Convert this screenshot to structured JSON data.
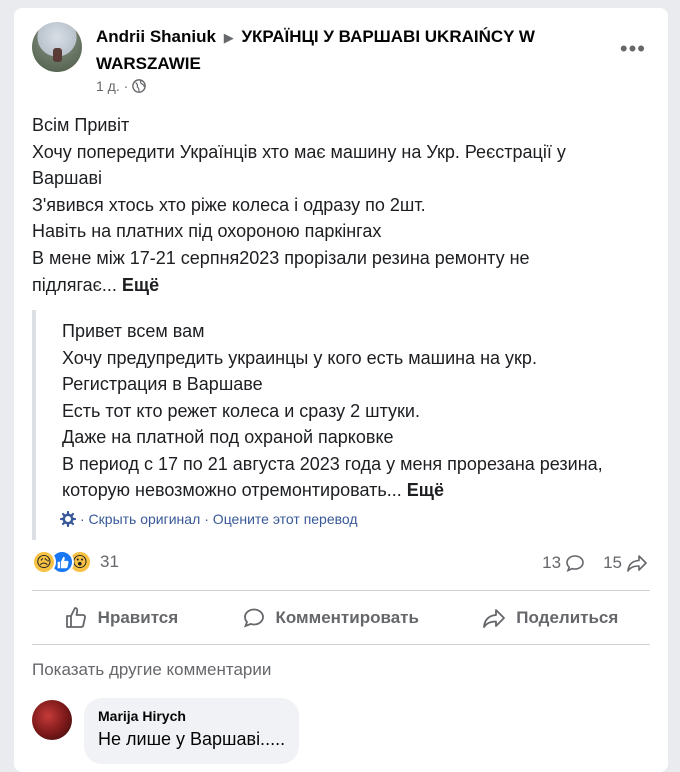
{
  "post": {
    "author": "Andrii Shaniuk",
    "group": "УКРАЇНЦІ У ВАРШАВІ UKRAIŃCY W WARSZAWIE",
    "time": "1 д. ·",
    "text_lines": [
      "Всім Привіт",
      "Хочу попередити Українців хто має машину на Укр. Реєстрації у",
      "Варшаві",
      "З'явився хтось хто ріже колеса і одразу по 2шт.",
      "Навіть на платних під охороною паркінгах",
      "В мене між 17-21 серпня2023 прорізали резина ремонту не",
      "підлягає..."
    ],
    "see_more": "Ещё"
  },
  "translation": {
    "lines": [
      "Привет всем вам",
      "Хочу предупредить украинцы у кого есть машина на укр.",
      "Регистрация в Варшаве",
      "Есть тот кто режет колеса и сразу 2 штуки.",
      "Даже на платной под охраной парковке",
      "В период с 17 по 21 августа 2023 года у меня прорезана резина,",
      "которую невозможно отремонтировать..."
    ],
    "see_more": "Ещё",
    "hide_original": "· Скрыть оригинал",
    "rate": "· Оцените этот перевод"
  },
  "stats": {
    "reactions_count": "31",
    "comments_count": "13",
    "shares_count": "15"
  },
  "actions": {
    "like": "Нравится",
    "comment": "Комментировать",
    "share": "Поделиться"
  },
  "comments": {
    "show_more": "Показать другие комментарии",
    "items": [
      {
        "author": "Marija Hirych",
        "text": "Не лише у Варшаві....."
      }
    ]
  },
  "icons": {
    "options": "more-horizontal-icon",
    "privacy": "globe-icon",
    "translate": "gear-icon",
    "comment_stat": "speech-bubble-icon",
    "share_stat": "share-arrow-icon"
  },
  "colors": {
    "link": "#385898",
    "like_blue": "#1877f2",
    "secondary_text": "#65676b"
  }
}
